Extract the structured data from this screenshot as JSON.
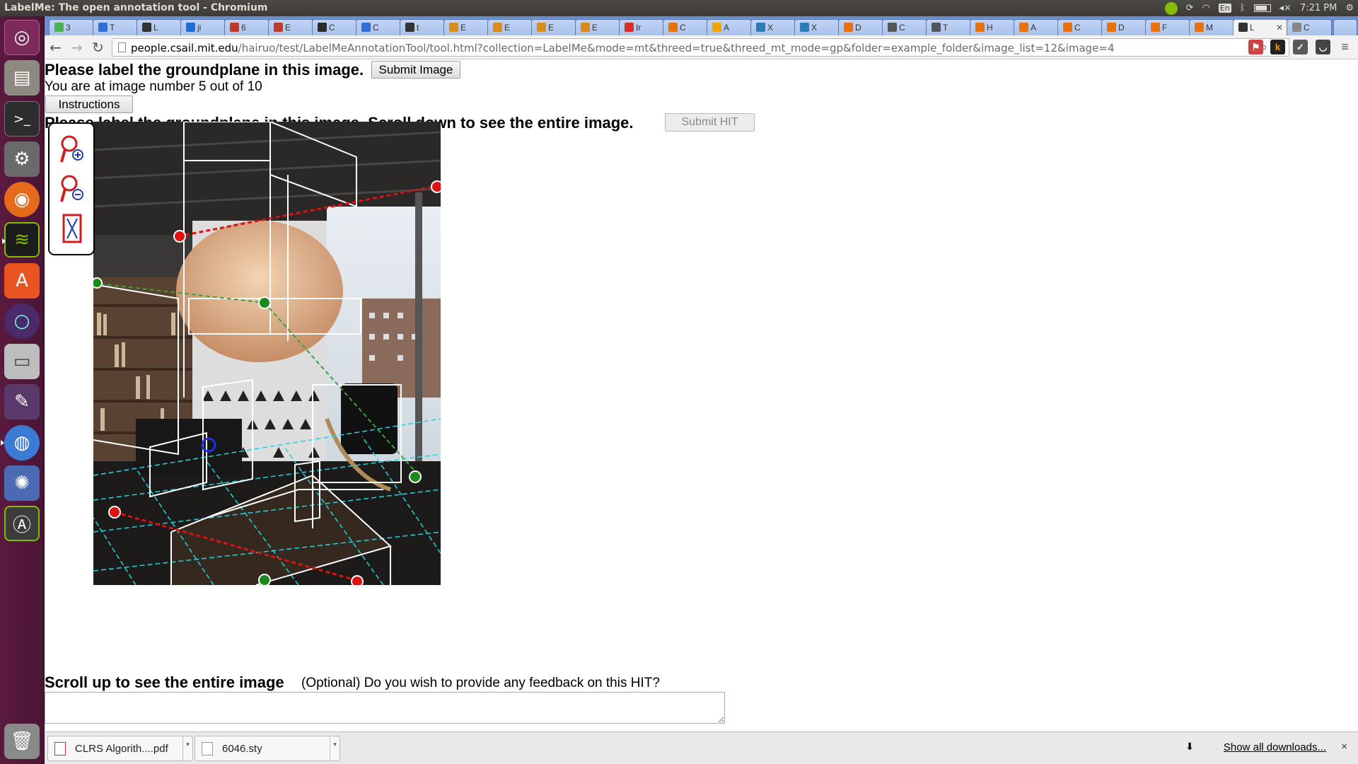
{
  "os": {
    "window_title": "LabelMe: The open annotation tool - Chromium",
    "keyboard_layout": "En",
    "clock": "7:21 PM"
  },
  "tabs": [
    {
      "label": "3",
      "color": "#4caf50"
    },
    {
      "label": "T",
      "color": "#2f6fd8"
    },
    {
      "label": "L",
      "color": "#333333"
    },
    {
      "label": "ji",
      "color": "#1e6bd6"
    },
    {
      "label": "6",
      "color": "#c0392b"
    },
    {
      "label": "E",
      "color": "#c0392b"
    },
    {
      "label": "C",
      "color": "#2b2b2b"
    },
    {
      "label": "C",
      "color": "#2f6fd8"
    },
    {
      "label": "t",
      "color": "#333333"
    },
    {
      "label": "E",
      "color": "#d88c1a"
    },
    {
      "label": "E",
      "color": "#d88c1a"
    },
    {
      "label": "E",
      "color": "#d88c1a"
    },
    {
      "label": "E",
      "color": "#d88c1a"
    },
    {
      "label": "Ir",
      "color": "#d93025"
    },
    {
      "label": "C",
      "color": "#e8710a"
    },
    {
      "label": "A",
      "color": "#f2a600"
    },
    {
      "label": "X",
      "color": "#2b7bb9"
    },
    {
      "label": "X",
      "color": "#2b7bb9"
    },
    {
      "label": "D",
      "color": "#e8710a"
    },
    {
      "label": "C",
      "color": "#555555"
    },
    {
      "label": "T",
      "color": "#555555"
    },
    {
      "label": "H",
      "color": "#e8710a"
    },
    {
      "label": "A",
      "color": "#e8710a"
    },
    {
      "label": "C",
      "color": "#e8710a"
    },
    {
      "label": "D",
      "color": "#e8710a"
    },
    {
      "label": "F",
      "color": "#e8710a"
    },
    {
      "label": "M",
      "color": "#e8710a"
    },
    {
      "label": "L",
      "color": "#333333",
      "active": true
    },
    {
      "label": "C",
      "color": "#888888"
    }
  ],
  "browser": {
    "url_host": "people.csail.mit.edu",
    "url_path": "/hairuo/test/LabelMeAnnotationTool/tool.html?collection=LabelMe&mode=mt&threed=true&threed_mt_mode=gp&folder=example_folder&image_list=12&image=4"
  },
  "page": {
    "heading": "Please label the groundplane in this image.",
    "submit_image_label": "Submit Image",
    "progress_text": "You are at image number 5 out of 10",
    "instructions_label": "Instructions",
    "subheading": "Please label the groundplane in this image. Scroll down to see the entire image.",
    "submit_hit_label": "Submit HIT",
    "scroll_up_text": "Scroll up to see the entire image",
    "feedback_prompt": "(Optional) Do you wish to provide any feedback on this HIT?",
    "feedback_value": ""
  },
  "downloads": {
    "items": [
      {
        "label": "CLRS Algorith....pdf",
        "icon": "pdf-icon"
      },
      {
        "label": "6046.sty",
        "icon": "file-icon"
      }
    ],
    "show_all_label": "Show all downloads...",
    "close_label": "×"
  }
}
